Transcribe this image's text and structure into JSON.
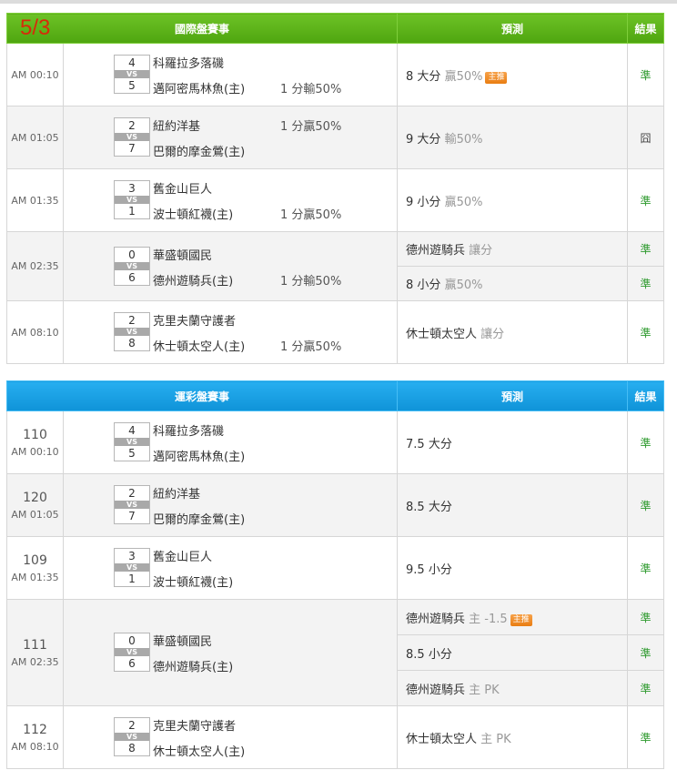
{
  "date_stamp": "5/3",
  "tables": [
    {
      "id": "intl",
      "header": {
        "title": "國際盤賽事",
        "prediction": "預測",
        "result": "結果"
      },
      "games": [
        {
          "time": "AM 00:10",
          "away": {
            "score": "4",
            "name": "科羅拉多落磯"
          },
          "home": {
            "score": "5",
            "name": "邁阿密馬林魚(主)"
          },
          "vs": "VS",
          "line": "1 分輸50%",
          "line_row": "home",
          "preds": [
            {
              "main": "8 大分",
              "note": "贏50%",
              "badge": "主推",
              "result": "準",
              "result_type": "win"
            }
          ]
        },
        {
          "time": "AM 01:05",
          "away": {
            "score": "2",
            "name": "紐約洋基"
          },
          "home": {
            "score": "7",
            "name": "巴爾的摩金鶯(主)"
          },
          "vs": "VS",
          "line": "1 分贏50%",
          "line_row": "away",
          "preds": [
            {
              "main": "9 大分",
              "note": "輸50%",
              "badge": "",
              "result": "囧",
              "result_type": "lose"
            }
          ]
        },
        {
          "time": "AM 01:35",
          "away": {
            "score": "3",
            "name": "舊金山巨人"
          },
          "home": {
            "score": "1",
            "name": "波士頓紅襪(主)"
          },
          "vs": "VS",
          "line": "1 分贏50%",
          "line_row": "home",
          "preds": [
            {
              "main": "9 小分",
              "note": "贏50%",
              "badge": "",
              "result": "準",
              "result_type": "win"
            }
          ]
        },
        {
          "time": "AM 02:35",
          "away": {
            "score": "0",
            "name": "華盛頓國民"
          },
          "home": {
            "score": "6",
            "name": "德州遊騎兵(主)"
          },
          "vs": "VS",
          "line": "1 分輸50%",
          "line_row": "home",
          "preds": [
            {
              "main": "德州遊騎兵",
              "note": "讓分",
              "badge": "",
              "result": "準",
              "result_type": "win"
            },
            {
              "main": "8 小分",
              "note": "贏50%",
              "badge": "",
              "result": "準",
              "result_type": "win"
            }
          ]
        },
        {
          "time": "AM 08:10",
          "away": {
            "score": "2",
            "name": "克里夫蘭守護者"
          },
          "home": {
            "score": "8",
            "name": "休士頓太空人(主)"
          },
          "vs": "VS",
          "line": "1 分贏50%",
          "line_row": "home",
          "preds": [
            {
              "main": "休士頓太空人",
              "note": "讓分",
              "badge": "",
              "result": "準",
              "result_type": "win"
            }
          ]
        }
      ]
    },
    {
      "id": "lottery",
      "header": {
        "title": "運彩盤賽事",
        "prediction": "預測",
        "result": "結果"
      },
      "games": [
        {
          "code": "110",
          "time": "AM 00:10",
          "away": {
            "score": "4",
            "name": "科羅拉多落磯"
          },
          "home": {
            "score": "5",
            "name": "邁阿密馬林魚(主)"
          },
          "vs": "VS",
          "line": "",
          "line_row": "",
          "preds": [
            {
              "main": "7.5 大分",
              "note": "",
              "badge": "",
              "result": "準",
              "result_type": "win"
            }
          ]
        },
        {
          "code": "120",
          "time": "AM 01:05",
          "away": {
            "score": "2",
            "name": "紐約洋基"
          },
          "home": {
            "score": "7",
            "name": "巴爾的摩金鶯(主)"
          },
          "vs": "VS",
          "line": "",
          "line_row": "",
          "preds": [
            {
              "main": "8.5 大分",
              "note": "",
              "badge": "",
              "result": "準",
              "result_type": "win"
            }
          ]
        },
        {
          "code": "109",
          "time": "AM 01:35",
          "away": {
            "score": "3",
            "name": "舊金山巨人"
          },
          "home": {
            "score": "1",
            "name": "波士頓紅襪(主)"
          },
          "vs": "VS",
          "line": "",
          "line_row": "",
          "preds": [
            {
              "main": "9.5 小分",
              "note": "",
              "badge": "",
              "result": "準",
              "result_type": "win"
            }
          ]
        },
        {
          "code": "111",
          "time": "AM 02:35",
          "away": {
            "score": "0",
            "name": "華盛頓國民"
          },
          "home": {
            "score": "6",
            "name": "德州遊騎兵(主)"
          },
          "vs": "VS",
          "line": "",
          "line_row": "",
          "preds": [
            {
              "main": "德州遊騎兵",
              "note": "主 -1.5",
              "badge": "主推",
              "result": "準",
              "result_type": "win"
            },
            {
              "main": "8.5 小分",
              "note": "",
              "badge": "",
              "result": "準",
              "result_type": "win"
            },
            {
              "main": "德州遊騎兵",
              "note": "主 PK",
              "badge": "",
              "result": "準",
              "result_type": "win"
            }
          ]
        },
        {
          "code": "112",
          "time": "AM 08:10",
          "away": {
            "score": "2",
            "name": "克里夫蘭守護者"
          },
          "home": {
            "score": "8",
            "name": "休士頓太空人(主)"
          },
          "vs": "VS",
          "line": "",
          "line_row": "",
          "preds": [
            {
              "main": "休士頓太空人",
              "note": "主 PK",
              "badge": "",
              "result": "準",
              "result_type": "win"
            }
          ]
        }
      ]
    }
  ]
}
